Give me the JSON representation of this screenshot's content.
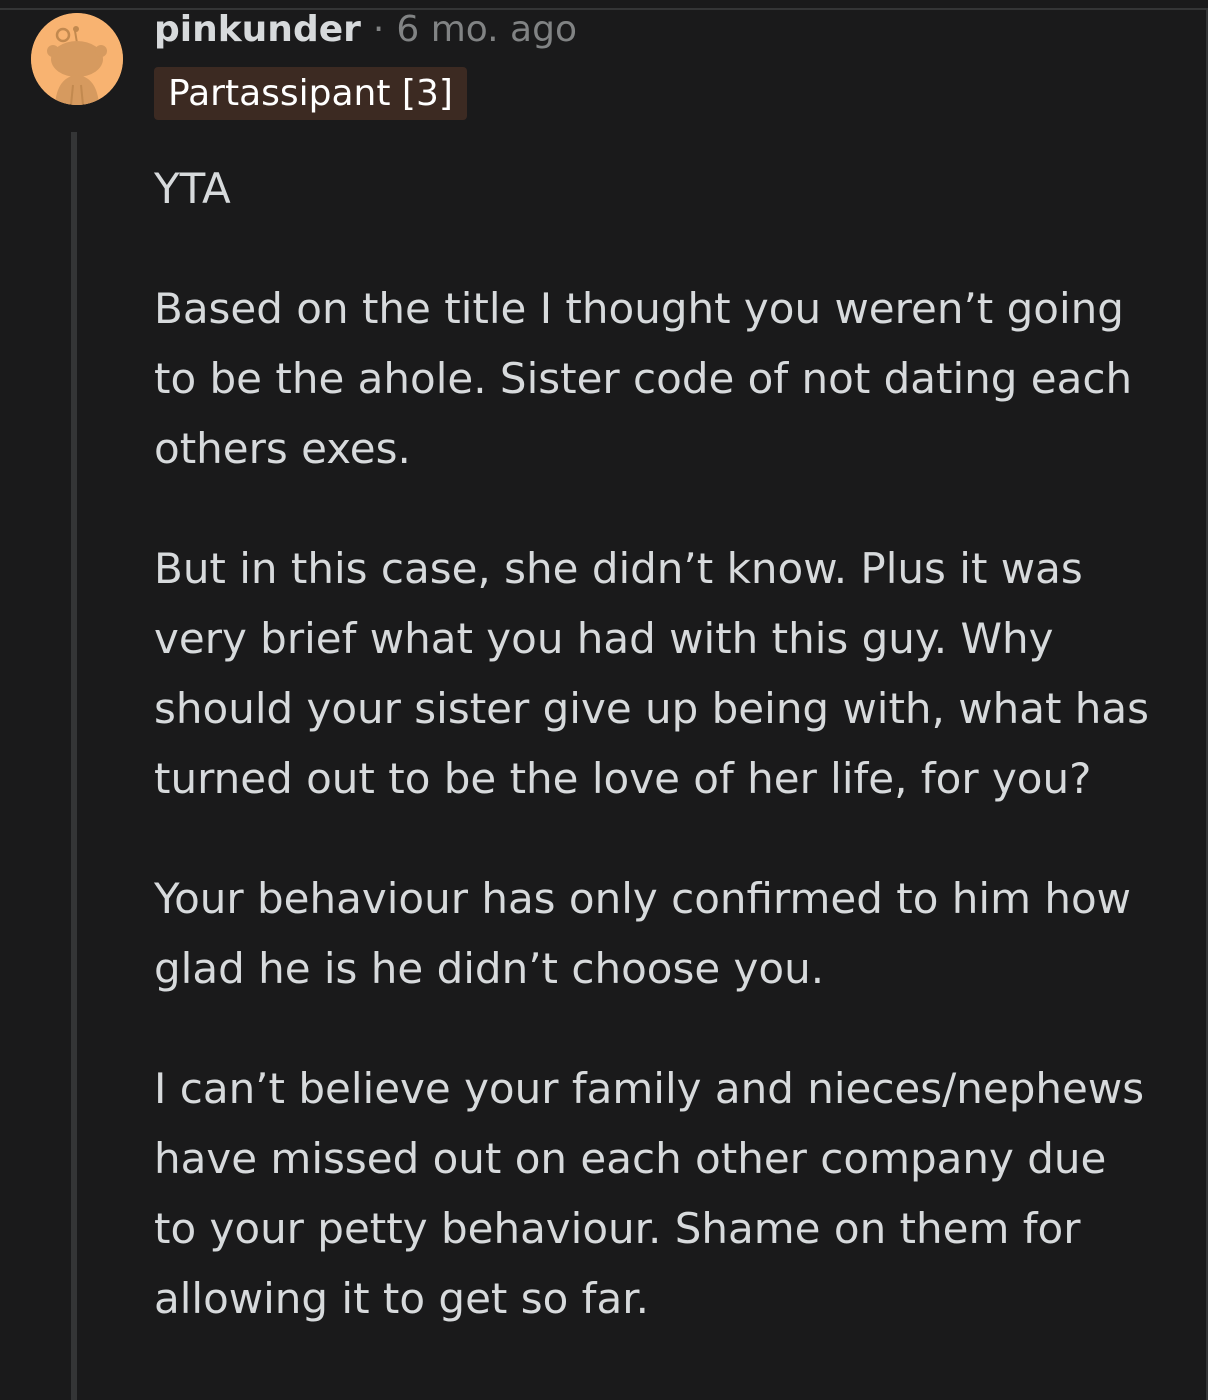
{
  "comment": {
    "author": "pinkunder",
    "separator": "·",
    "timestamp": "6 mo. ago",
    "flair": "Partassipant [3]",
    "paragraphs": [
      "YTA",
      "Based on the title I thought you weren’t going to be the ahole. Sister code of not dating each others exes.",
      "But in this case, she didn’t know. Plus it was very brief what you had with this guy. Why should your sister give up being with, what has turned out to be the love of her life, for you?",
      "Your behaviour has only confirmed to him how glad he is he didn’t choose you.",
      "I can’t believe your family and nieces/nephews have missed out on each other company due to your petty behaviour. Shame on them for allowing it to get so far."
    ]
  },
  "avatar": {
    "icon": "snoo-avatar-icon",
    "background_color": "#f8b371"
  },
  "colors": {
    "background": "#1a1a1b",
    "text": "#d7dadc",
    "muted": "#818384",
    "flair_bg": "#3c2a22",
    "thread_line": "#343536"
  }
}
